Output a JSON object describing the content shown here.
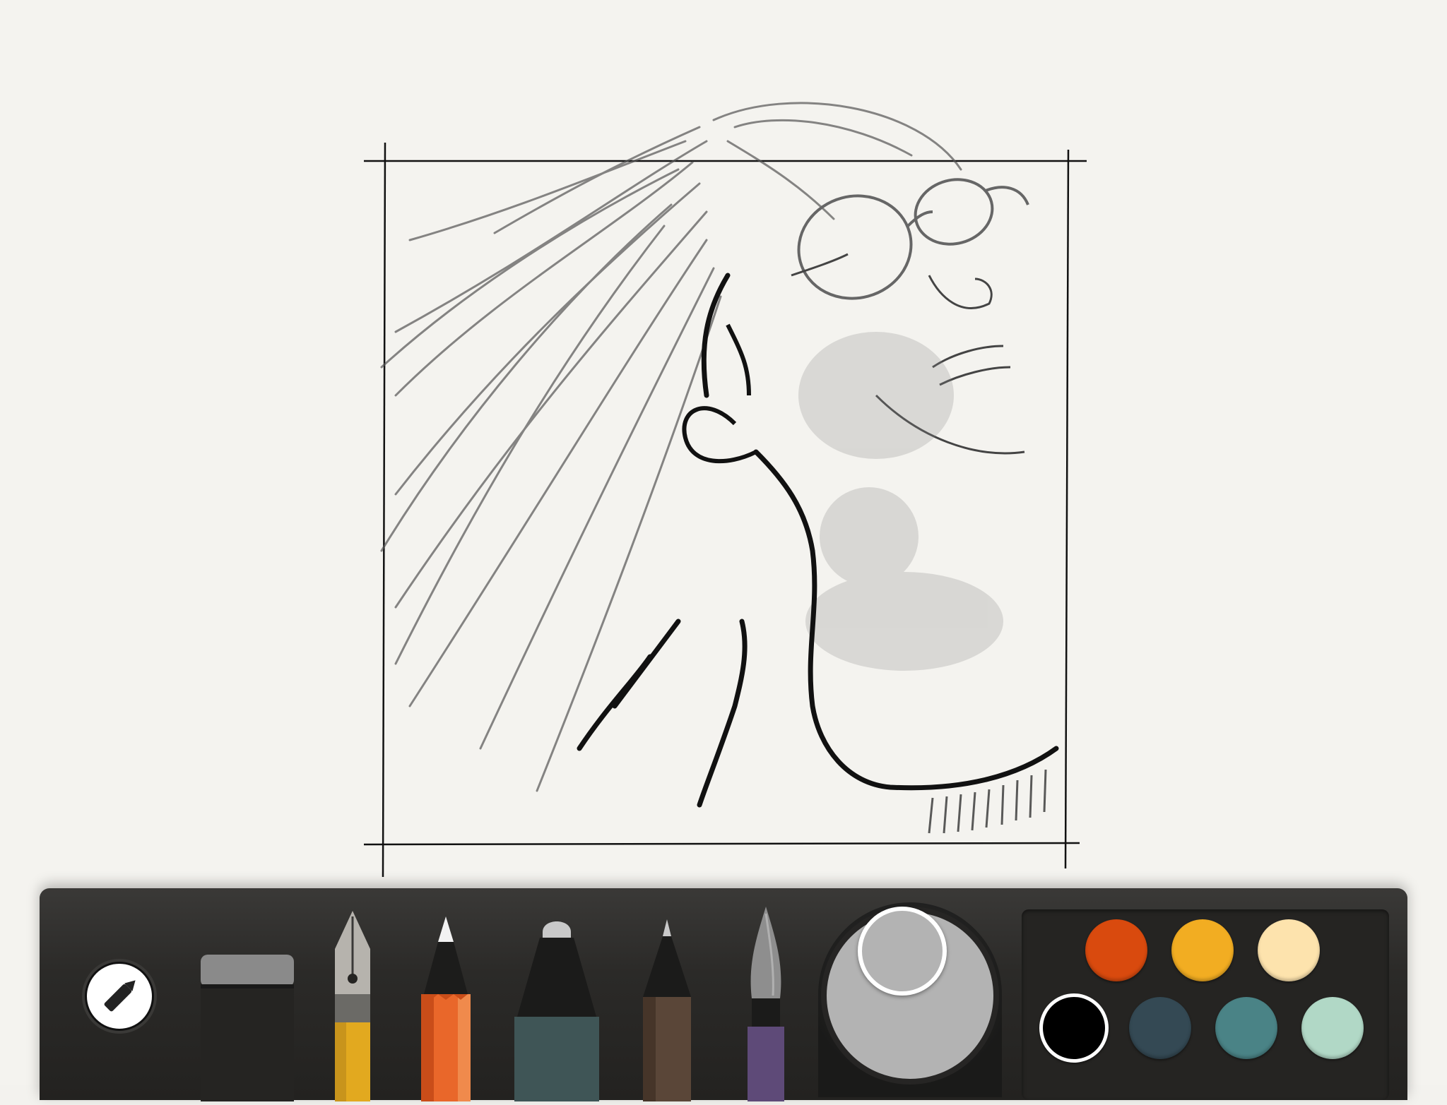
{
  "app": {
    "background_color": "#f4f3ef",
    "toolbar_color": "#2b2a28"
  },
  "tools": [
    {
      "id": "eraser",
      "icon": "eraser-icon"
    },
    {
      "id": "fountain-pen",
      "icon": "fountain-pen-icon"
    },
    {
      "id": "pencil",
      "icon": "pencil-icon"
    },
    {
      "id": "marker",
      "icon": "marker-icon"
    },
    {
      "id": "outline-pen",
      "icon": "outline-pen-icon"
    },
    {
      "id": "brush",
      "icon": "watercolor-brush-icon"
    }
  ],
  "mixer": {
    "current_color": "#b3b3b3"
  },
  "palette": {
    "selected_index": 3,
    "colors": [
      "#d94a0e",
      "#f2ad22",
      "#fde3ad",
      "#000000",
      "#344954",
      "#4a8386",
      "#b1d8c6"
    ]
  },
  "edit_button": {
    "icon": "pencil-edit-icon"
  }
}
